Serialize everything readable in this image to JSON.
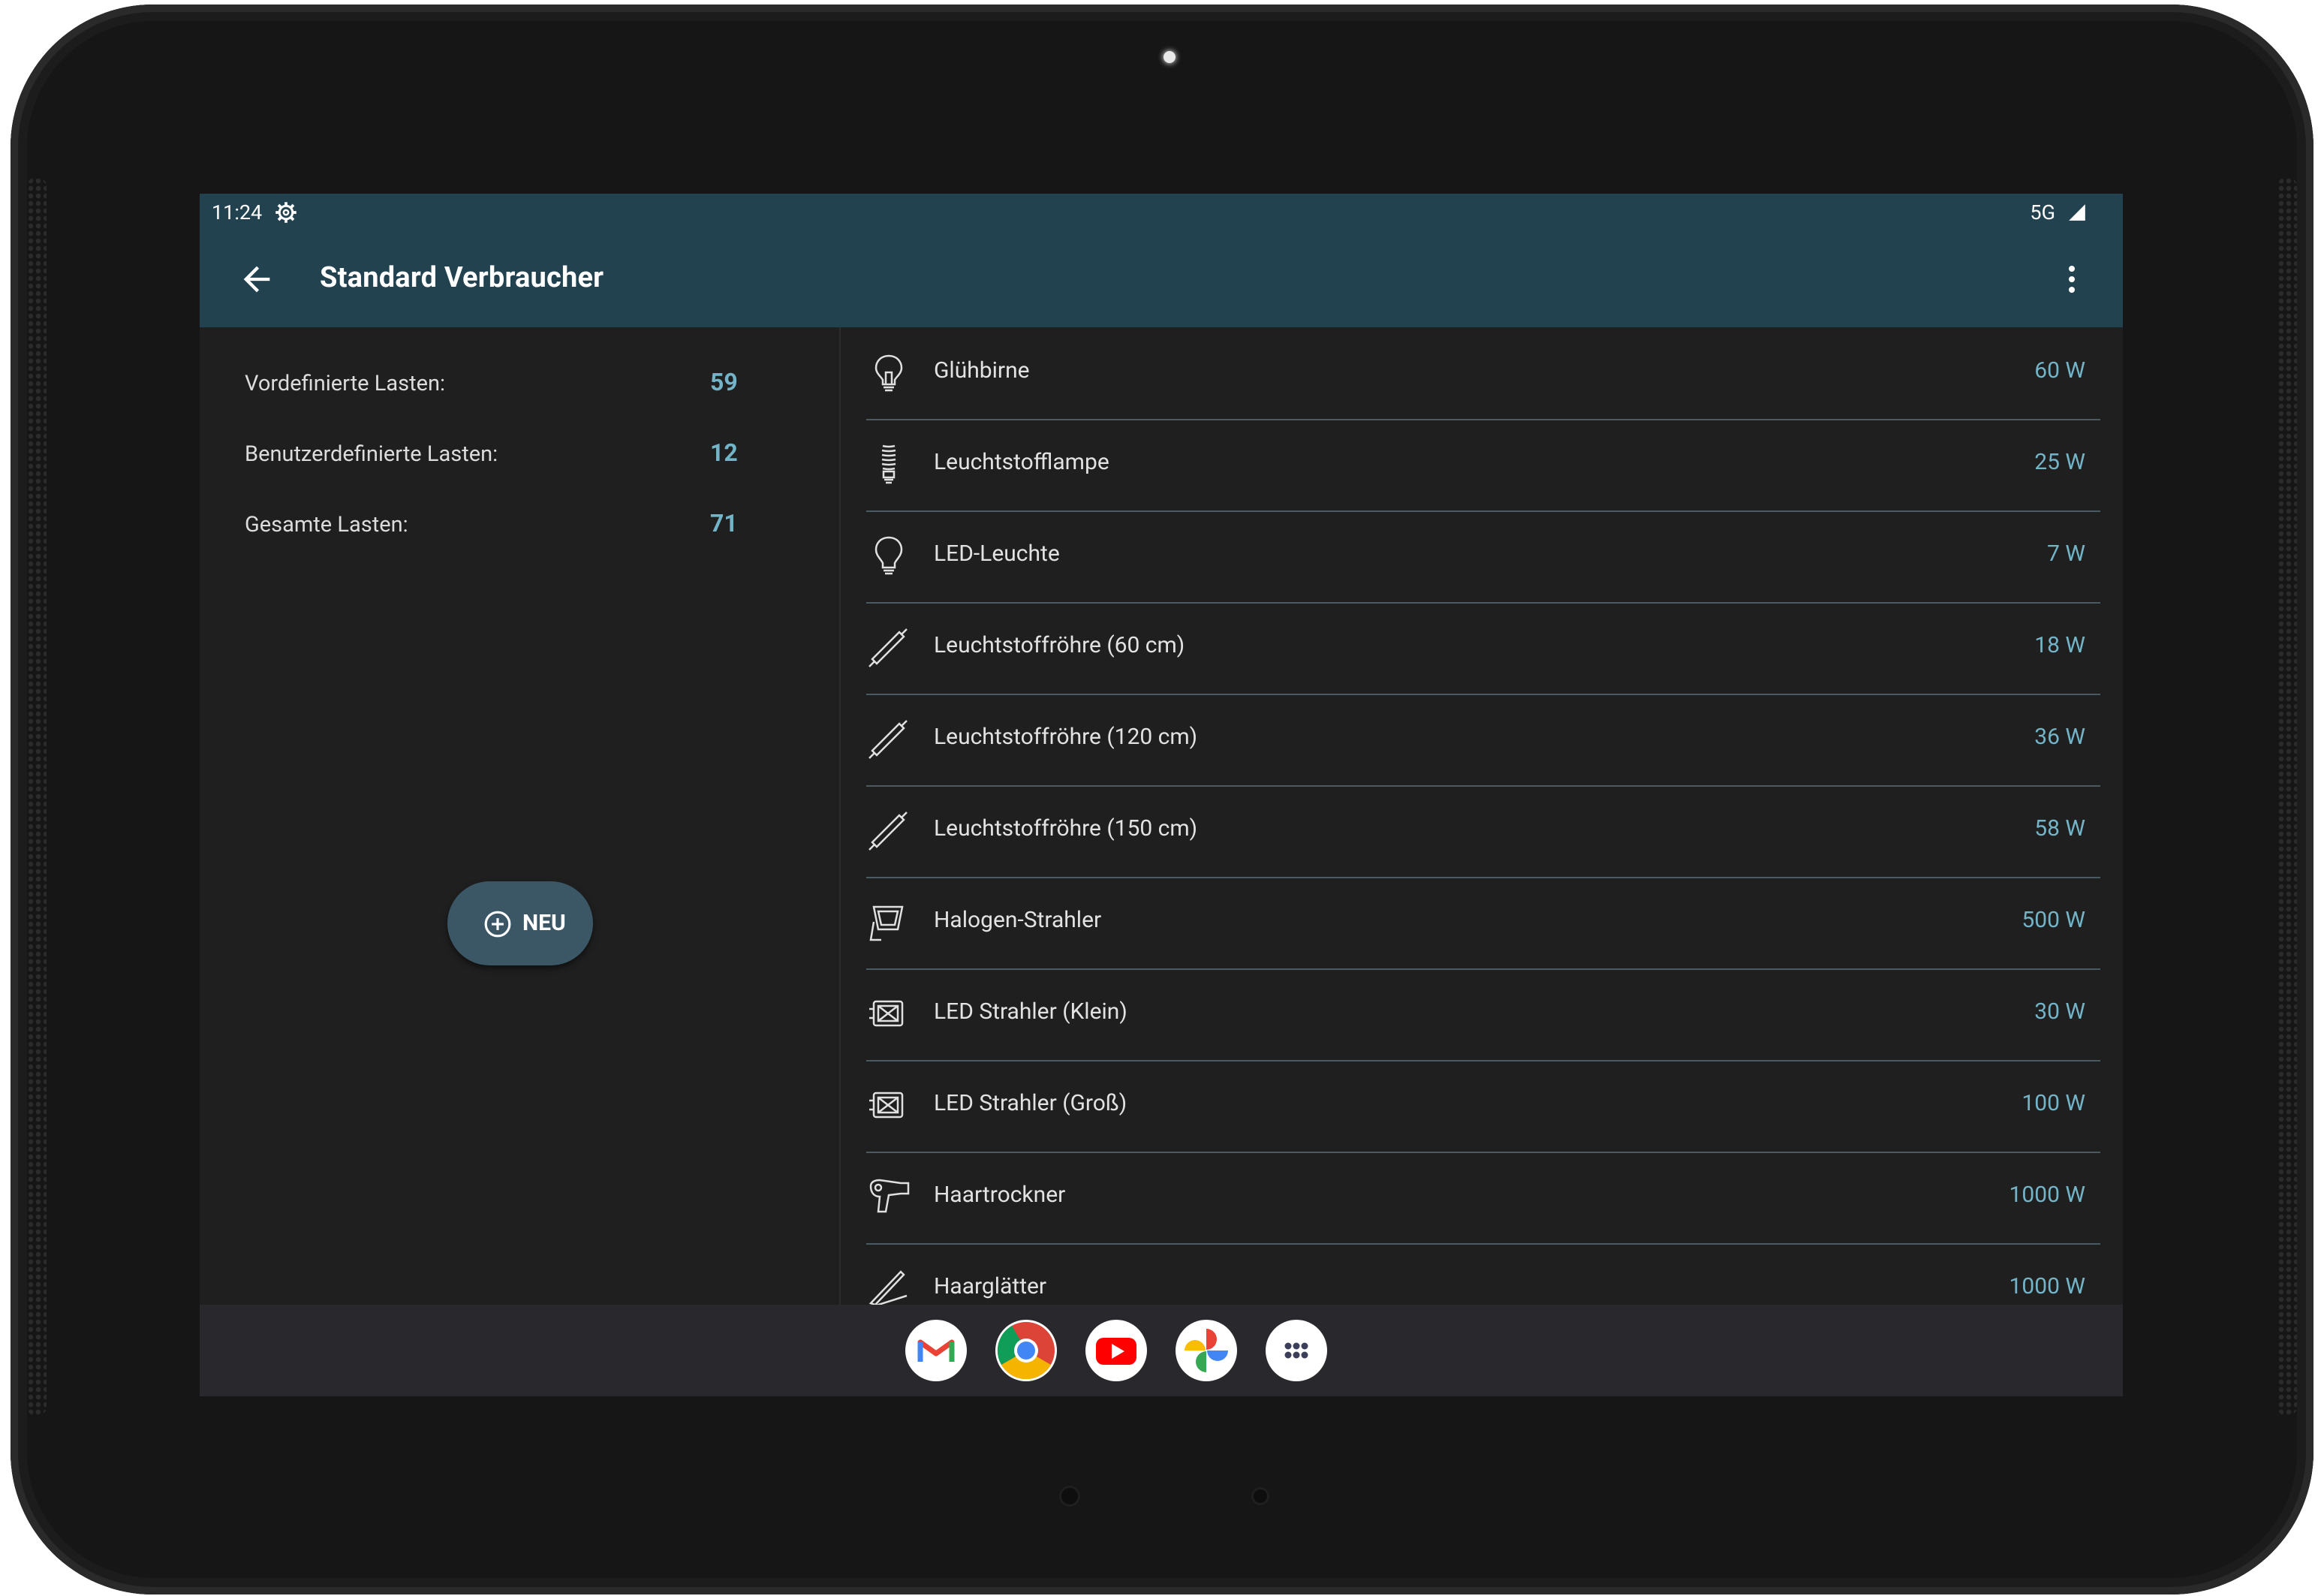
{
  "status_bar": {
    "time": "11:24",
    "network": "5G"
  },
  "app_bar": {
    "title": "Standard Verbraucher"
  },
  "stats": [
    {
      "label": "Vordefinierte Lasten:",
      "value": "59"
    },
    {
      "label": "Benutzerdefinierte Lasten:",
      "value": "12"
    },
    {
      "label": "Gesamte Lasten:",
      "value": "71"
    }
  ],
  "fab": {
    "label": "NEU"
  },
  "loads": [
    {
      "name": "Glühbirne",
      "watt": "60 W",
      "icon": "light-bulb-icon"
    },
    {
      "name": "Leuchtstofflampe",
      "watt": "25 W",
      "icon": "cfl-bulb-icon"
    },
    {
      "name": "LED-Leuchte",
      "watt": "7 W",
      "icon": "led-bulb-icon"
    },
    {
      "name": "Leuchtstoffröhre (60 cm)",
      "watt": "18 W",
      "icon": "tube-light-icon"
    },
    {
      "name": "Leuchtstoffröhre (120 cm)",
      "watt": "36 W",
      "icon": "tube-light-icon"
    },
    {
      "name": "Leuchtstoffröhre (150 cm)",
      "watt": "58 W",
      "icon": "tube-light-icon"
    },
    {
      "name": "Halogen-Strahler",
      "watt": "500 W",
      "icon": "halogen-spotlight-icon"
    },
    {
      "name": "LED Strahler (Klein)",
      "watt": "30 W",
      "icon": "led-floodlight-icon"
    },
    {
      "name": "LED Strahler (Groß)",
      "watt": "100 W",
      "icon": "led-floodlight-icon"
    },
    {
      "name": "Haartrockner",
      "watt": "1000 W",
      "icon": "hair-dryer-icon"
    },
    {
      "name": "Haarglätter",
      "watt": "1000 W",
      "icon": "hair-straightener-icon"
    }
  ],
  "taskbar": [
    "gmail-icon",
    "chrome-icon",
    "youtube-icon",
    "photos-icon",
    "app-drawer-icon"
  ],
  "colors": {
    "app_bar": "#224250",
    "accent_value": "#73b4c8",
    "background": "#1f1f1f",
    "fab": "#3b5766"
  }
}
